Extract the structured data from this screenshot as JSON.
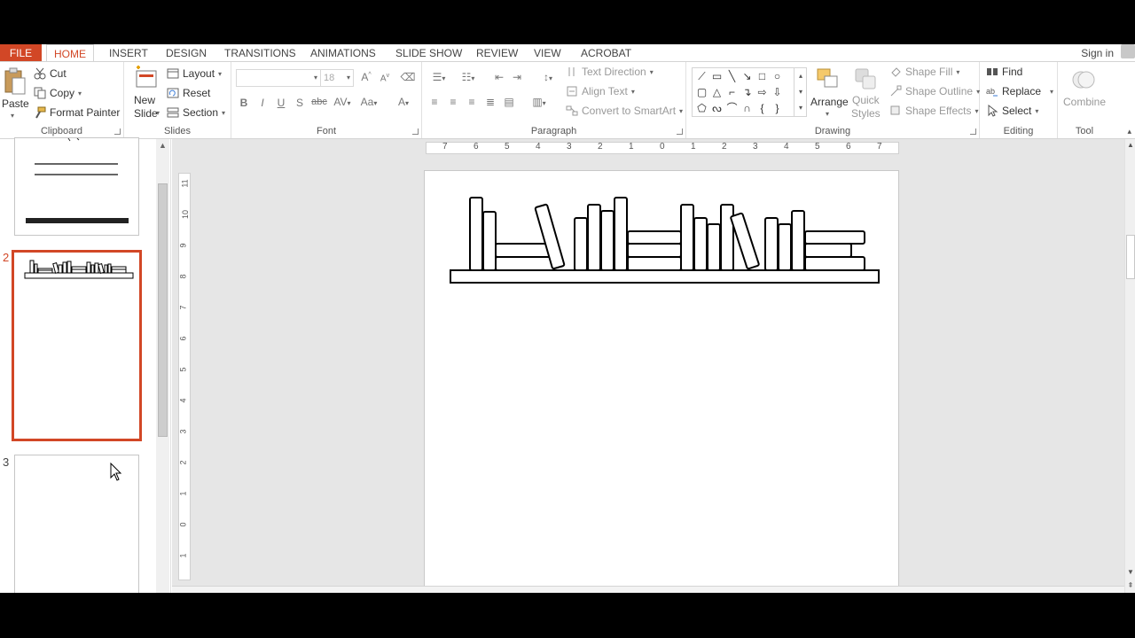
{
  "tabs": {
    "file": "FILE",
    "home": "HOME",
    "insert": "INSERT",
    "design": "DESIGN",
    "transitions": "TRANSITIONS",
    "animations": "ANIMATIONS",
    "slide_show": "SLIDE SHOW",
    "review": "REVIEW",
    "view": "VIEW",
    "acrobat": "ACROBAT"
  },
  "account": {
    "sign_in": "Sign in"
  },
  "clipboard": {
    "paste": "Paste",
    "cut": "Cut",
    "copy": "Copy",
    "format_painter": "Format Painter",
    "label": "Clipboard"
  },
  "slides": {
    "new_slide_line1": "New",
    "new_slide_line2": "Slide",
    "layout": "Layout",
    "reset": "Reset",
    "section": "Section",
    "label": "Slides"
  },
  "font": {
    "name": "",
    "size": "18",
    "bold": "B",
    "italic": "I",
    "underline": "U",
    "shadow": "S",
    "strike": "abc",
    "spacing": "AV",
    "case": "Aa",
    "color": "A",
    "grow": "A",
    "shrink": "A",
    "label": "Font"
  },
  "paragraph": {
    "text_direction": "Text Direction",
    "align_text": "Align Text",
    "convert_smartart": "Convert to SmartArt",
    "label": "Paragraph"
  },
  "drawing": {
    "arrange": "Arrange",
    "quick_styles_line1": "Quick",
    "quick_styles_line2": "Styles",
    "shape_fill": "Shape Fill",
    "shape_outline": "Shape Outline",
    "shape_effects": "Shape Effects",
    "label": "Drawing"
  },
  "editing": {
    "find": "Find",
    "replace": "Replace",
    "select": "Select",
    "label": "Editing"
  },
  "tool": {
    "combine": "Combine",
    "label": "Tool"
  },
  "thumbnails": {
    "numbers": [
      "2",
      "3"
    ]
  },
  "ruler": {
    "horizontal": [
      "7",
      "6",
      "5",
      "4",
      "3",
      "2",
      "1",
      "0",
      "1",
      "2",
      "3",
      "4",
      "5",
      "6",
      "7"
    ],
    "vertical": [
      "11",
      "10",
      "9",
      "8",
      "7",
      "6",
      "5",
      "4",
      "3",
      "2",
      "1",
      "0",
      "1"
    ]
  },
  "colors": {
    "accent": "#d24726",
    "ribbon_bg": "#ffffff",
    "workspace_bg": "#e6e6e6"
  },
  "icons": [
    "paste-icon",
    "cut-icon",
    "copy-icon",
    "format-painter-icon",
    "new-slide-icon",
    "arrange-icon",
    "quick-styles-icon",
    "find-icon",
    "replace-icon",
    "select-icon",
    "combine-icon"
  ]
}
